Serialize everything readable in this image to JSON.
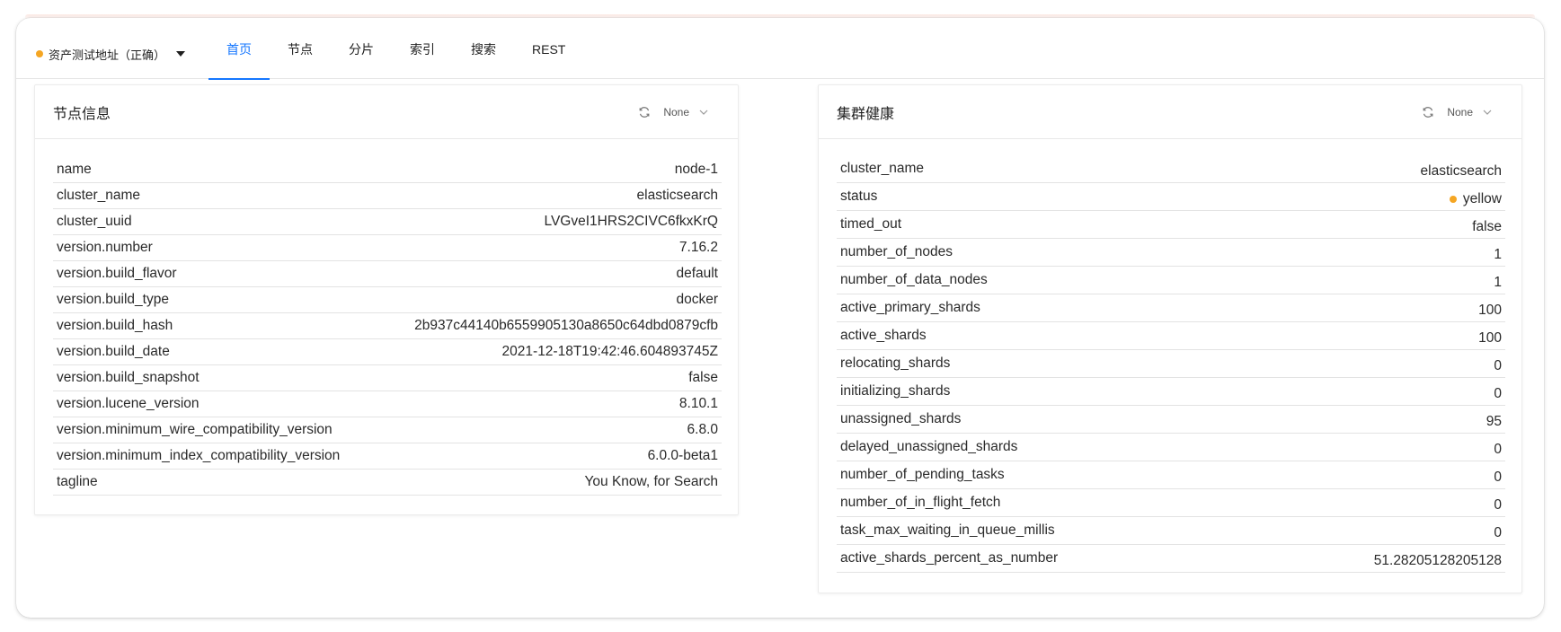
{
  "colors": {
    "accent": "#1677ff",
    "status_yellow": "#f5a623"
  },
  "cluster_selector": {
    "label": "资产测试地址（正确）",
    "status_color": "#f5a623",
    "caret_icon": "caret-down-icon"
  },
  "tabs": [
    {
      "label": "首页",
      "active": true
    },
    {
      "label": "节点",
      "active": false
    },
    {
      "label": "分片",
      "active": false
    },
    {
      "label": "索引",
      "active": false
    },
    {
      "label": "搜索",
      "active": false
    },
    {
      "label": "REST",
      "active": false
    }
  ],
  "node_info": {
    "title": "节点信息",
    "refresh_icon": "refresh-icon",
    "interval": "None",
    "rows": [
      {
        "key": "name",
        "value": "node-1"
      },
      {
        "key": "cluster_name",
        "value": "elasticsearch"
      },
      {
        "key": "cluster_uuid",
        "value": "LVGveI1HRS2CIVC6fkxKrQ"
      },
      {
        "key": "version.number",
        "value": "7.16.2"
      },
      {
        "key": "version.build_flavor",
        "value": "default"
      },
      {
        "key": "version.build_type",
        "value": "docker"
      },
      {
        "key": "version.build_hash",
        "value": "2b937c44140b6559905130a8650c64dbd0879cfb"
      },
      {
        "key": "version.build_date",
        "value": "2021-12-18T19:42:46.604893745Z"
      },
      {
        "key": "version.build_snapshot",
        "value": "false"
      },
      {
        "key": "version.lucene_version",
        "value": "8.10.1"
      },
      {
        "key": "version.minimum_wire_compatibility_version",
        "value": "6.8.0"
      },
      {
        "key": "version.minimum_index_compatibility_version",
        "value": "6.0.0-beta1"
      },
      {
        "key": "tagline",
        "value": "You Know, for Search"
      }
    ]
  },
  "cluster_health": {
    "title": "集群健康",
    "refresh_icon": "refresh-icon",
    "interval": "None",
    "rows": [
      {
        "key": "cluster_name",
        "value": "elasticsearch"
      },
      {
        "key": "status",
        "value": "yellow",
        "dot_color": "#f5a623"
      },
      {
        "key": "timed_out",
        "value": "false"
      },
      {
        "key": "number_of_nodes",
        "value": "1"
      },
      {
        "key": "number_of_data_nodes",
        "value": "1"
      },
      {
        "key": "active_primary_shards",
        "value": "100"
      },
      {
        "key": "active_shards",
        "value": "100"
      },
      {
        "key": "relocating_shards",
        "value": "0"
      },
      {
        "key": "initializing_shards",
        "value": "0"
      },
      {
        "key": "unassigned_shards",
        "value": "95"
      },
      {
        "key": "delayed_unassigned_shards",
        "value": "0"
      },
      {
        "key": "number_of_pending_tasks",
        "value": "0"
      },
      {
        "key": "number_of_in_flight_fetch",
        "value": "0"
      },
      {
        "key": "task_max_waiting_in_queue_millis",
        "value": "0"
      },
      {
        "key": "active_shards_percent_as_number",
        "value": "51.28205128205128"
      }
    ]
  }
}
